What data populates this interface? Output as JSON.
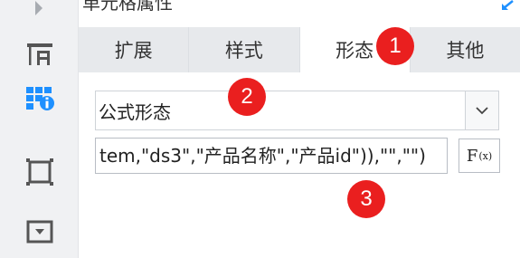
{
  "panel": {
    "title": "单元格属性"
  },
  "tabs": [
    {
      "label": "扩展",
      "active": false
    },
    {
      "label": "样式",
      "active": false
    },
    {
      "label": "形态",
      "active": true
    },
    {
      "label": "其他",
      "active": false
    }
  ],
  "form_select": {
    "value": "公式形态"
  },
  "formula_input": {
    "value": "tem,\"ds3\",\"产品名称\",\"产品id\")),\"\",\"\")"
  },
  "fx_button": {
    "label_main": "F",
    "label_sub": "(x)"
  },
  "annotations": [
    {
      "number": "1"
    },
    {
      "number": "2"
    },
    {
      "number": "3"
    }
  ],
  "colors": {
    "accent": "#1e90ff",
    "badge": "#ea1f1f",
    "tab_bg": "#e7e9ec",
    "active_tab_bg": "#ffffff"
  },
  "icons": [
    "expand-arrow-icon",
    "cell-layout-icon",
    "cell-properties-icon",
    "border-icon",
    "widget-icon",
    "dock-arrow-icon",
    "chevron-down-icon"
  ]
}
